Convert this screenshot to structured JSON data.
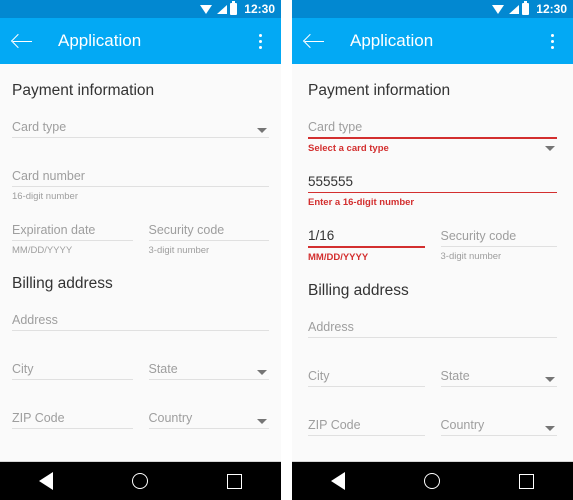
{
  "status_bar": {
    "time": "12:30",
    "icons": [
      "wifi-icon",
      "signal-icon",
      "battery-icon"
    ]
  },
  "app_bar": {
    "back_label": "back-arrow-icon",
    "title": "Application",
    "overflow_label": "overflow-menu-icon"
  },
  "nav_bar": {
    "back": "nav-back-icon",
    "home": "nav-home-icon",
    "recents": "nav-recents-icon"
  },
  "colors": {
    "status_bar": "#0288D1",
    "app_bar": "#03A9F4",
    "background": "#FAFAFA",
    "error": "#D32F2F",
    "hint": "#9E9E9E",
    "rule": "#E0E0E0",
    "text": "#333333"
  },
  "left_panel": {
    "payment_title": "Payment information",
    "card_type": {
      "label": "Card type",
      "value": "",
      "helper": "",
      "error": false
    },
    "card_number": {
      "label": "Card number",
      "value": "",
      "helper": "16-digit number",
      "error": false
    },
    "expiration_date": {
      "label": "Expiration date",
      "value": "",
      "helper": "MM/DD/YYYY",
      "error": false
    },
    "security_code": {
      "label": "Security code",
      "value": "",
      "helper": "3-digit number",
      "error": false
    },
    "billing_title": "Billing address",
    "address": {
      "label": "Address",
      "value": ""
    },
    "city": {
      "label": "City",
      "value": ""
    },
    "state": {
      "label": "State",
      "value": ""
    },
    "zip": {
      "label": "ZIP Code",
      "value": ""
    },
    "country": {
      "label": "Country",
      "value": ""
    }
  },
  "right_panel": {
    "payment_title": "Payment information",
    "card_type": {
      "label": "Card type",
      "value": "",
      "helper": "Select a card type",
      "error": true
    },
    "card_number": {
      "label": "555555",
      "value": "555555",
      "helper": "Enter a 16-digit number",
      "error": true
    },
    "expiration_date": {
      "label": "1/16",
      "value": "1/16",
      "helper": "MM/DD/YYYY",
      "error": true
    },
    "security_code": {
      "label": "Security code",
      "value": "",
      "helper": "3-digit number",
      "error": false
    },
    "billing_title": "Billing address",
    "address": {
      "label": "Address",
      "value": ""
    },
    "city": {
      "label": "City",
      "value": ""
    },
    "state": {
      "label": "State",
      "value": ""
    },
    "zip": {
      "label": "ZIP Code",
      "value": ""
    },
    "country": {
      "label": "Country",
      "value": ""
    }
  }
}
